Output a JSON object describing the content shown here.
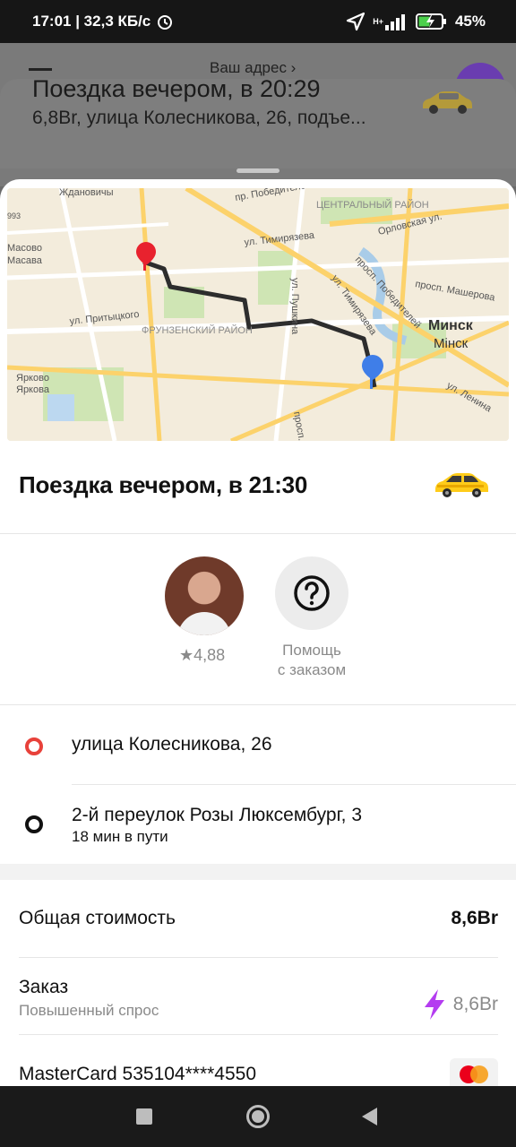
{
  "status_bar": {
    "time_speed": "17:01 | 32,3 КБ/с",
    "network": "H+",
    "battery": "45%"
  },
  "background": {
    "address_link": "Ваш адрес",
    "card_title": "Поездка вечером, в 20:29",
    "card_subtitle": "6,8Br, улица Колесникова, 26, подъе..."
  },
  "map": {
    "labels": [
      "Ждановичы",
      "пр. Победителей",
      "ЦЕНТРАЛЬНЫЙ РАЙОН",
      "ул. Тимирязева",
      "Орловская ул.",
      "Масово",
      "Масава",
      "ул. Притыцкого",
      "ФРУНЗЕНСКИЙ РАЙОН",
      "ул. Пушкина",
      "ул. Тимирязева",
      "просп. Победителей",
      "просп. Машерова",
      "Минск",
      "Мінск",
      "Ярково",
      "Яркова",
      "ул. Ленина",
      "просп.",
      "993"
    ]
  },
  "trip": {
    "title": "Поездка вечером, в 21:30"
  },
  "driver": {
    "rating": "★4,88"
  },
  "help": {
    "label_line1": "Помощь",
    "label_line2": "с заказом"
  },
  "route": {
    "from": "улица Колесникова, 26",
    "to": "2-й переулок Розы Люксембург, 3",
    "duration": "18 мин в пути"
  },
  "costs": {
    "total_label": "Общая стоимость",
    "total_value": "8,6Br",
    "order_label": "Заказ",
    "order_sub": "Повышенный спрос",
    "order_value": "8,6Br",
    "card_label": "MasterCard 535104****4550"
  },
  "colors": {
    "from_dot": "#e8413a",
    "surge": "#b43cf0",
    "route_line": "#2d2d2d"
  }
}
